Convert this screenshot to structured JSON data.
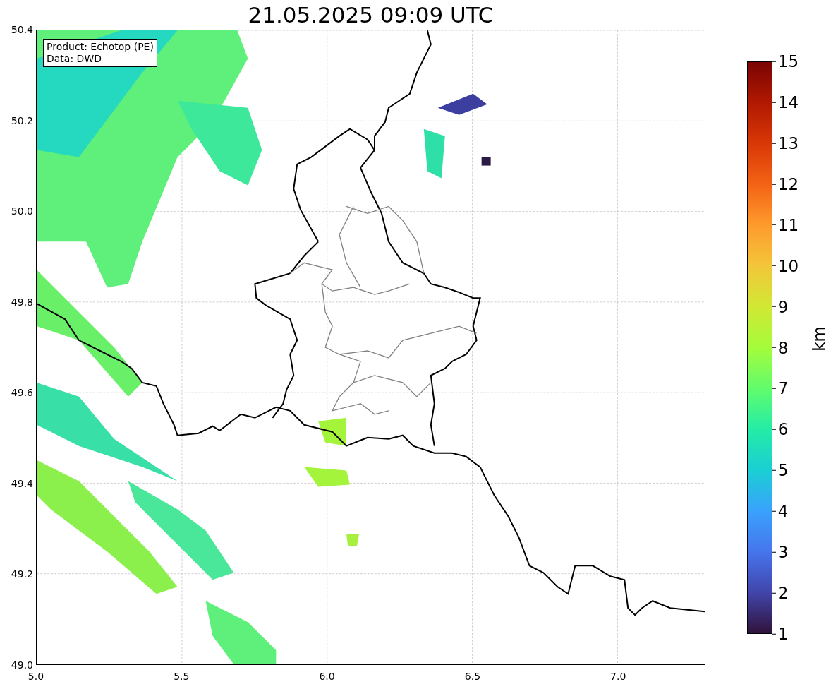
{
  "title": "21.05.2025 09:09 UTC",
  "info_box": [
    "Product: Echotop (PE)",
    "Data: DWD"
  ],
  "y_ticks": [
    "50.4",
    "50.2",
    "50.0",
    "49.8",
    "49.6",
    "49.4",
    "49.2",
    "49.0"
  ],
  "x_ticks": [
    "5.0",
    "5.5",
    "6.0",
    "6.5",
    "7.0"
  ],
  "colorbar": {
    "label": "km",
    "ticks": [
      "15",
      "14",
      "13",
      "12",
      "11",
      "10",
      "9",
      "8",
      "7",
      "6",
      "5",
      "4",
      "3",
      "2",
      "1"
    ]
  }
}
